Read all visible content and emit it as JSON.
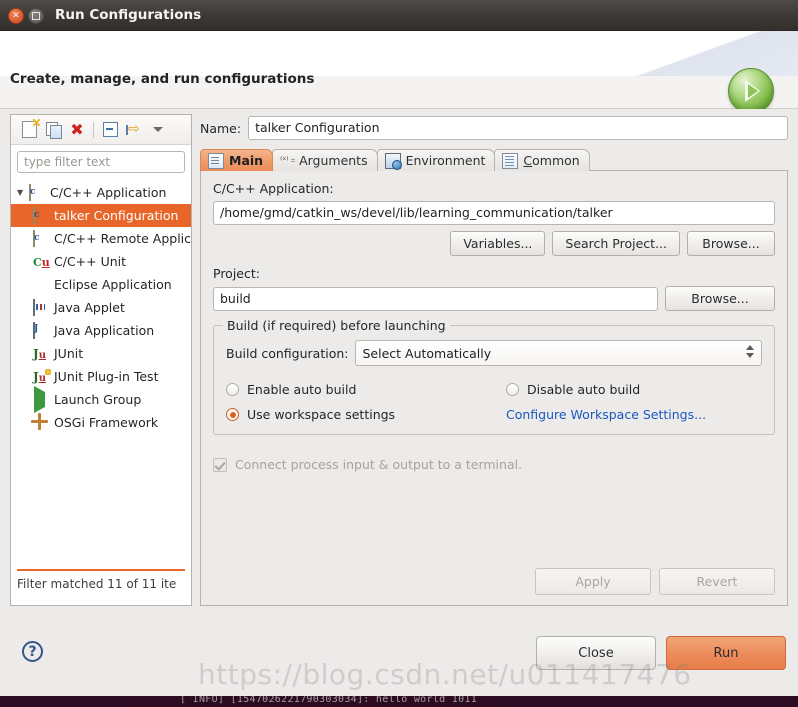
{
  "window": {
    "title": "Run Configurations",
    "close_icon": "close-icon",
    "maximize_icon": "maximize-icon"
  },
  "banner": {
    "heading": "Create, manage, and run configurations",
    "icon": "run-launch-icon"
  },
  "tree_toolbar": {
    "buttons": [
      {
        "name": "new-configuration-icon",
        "label": "New launch configuration"
      },
      {
        "name": "duplicate-icon",
        "label": "Duplicate"
      },
      {
        "name": "delete-icon",
        "label": "Delete"
      },
      {
        "name": "collapse-all-icon",
        "label": "Collapse All"
      },
      {
        "name": "filter-icon",
        "label": "Filter launch configurations"
      },
      {
        "name": "chevron-down-icon",
        "label": "View Menu"
      }
    ]
  },
  "filter": {
    "placeholder": "type filter text",
    "value": ""
  },
  "tree": {
    "items": [
      {
        "label": "C/C++ Application",
        "icon": "cpp-application-icon",
        "level": 0,
        "expanded": true,
        "selected": false
      },
      {
        "label": "talker Configuration",
        "icon": "cpp-application-icon",
        "level": 1,
        "expanded": false,
        "selected": true
      },
      {
        "label": "C/C++ Remote Applica",
        "icon": "cpp-remote-application-icon",
        "level": 0,
        "expanded": false,
        "selected": false
      },
      {
        "label": "C/C++ Unit",
        "icon": "cpp-unit-icon",
        "level": 0,
        "expanded": false,
        "selected": false
      },
      {
        "label": "Eclipse Application",
        "icon": "eclipse-application-icon",
        "level": 0,
        "expanded": false,
        "selected": false
      },
      {
        "label": "Java Applet",
        "icon": "java-applet-icon",
        "level": 0,
        "expanded": false,
        "selected": false
      },
      {
        "label": "Java Application",
        "icon": "java-application-icon",
        "level": 0,
        "expanded": false,
        "selected": false
      },
      {
        "label": "JUnit",
        "icon": "junit-icon",
        "level": 0,
        "expanded": false,
        "selected": false
      },
      {
        "label": "JUnit Plug-in Test",
        "icon": "junit-plugin-test-icon",
        "level": 0,
        "expanded": false,
        "selected": false
      },
      {
        "label": "Launch Group",
        "icon": "launch-group-icon",
        "level": 0,
        "expanded": false,
        "selected": false
      },
      {
        "label": "OSGi Framework",
        "icon": "osgi-framework-icon",
        "level": 0,
        "expanded": false,
        "selected": false
      }
    ],
    "status": "Filter matched 11 of 11 ite"
  },
  "form": {
    "name_label": "Name:",
    "name_value": "talker Configuration",
    "tabs": [
      {
        "label": "Main",
        "icon": "main-tab-icon",
        "active": true,
        "mnemonic": ""
      },
      {
        "label": "Arguments",
        "icon": "arguments-tab-icon",
        "active": false,
        "mnemonic": ""
      },
      {
        "label": "Environment",
        "icon": "environment-tab-icon",
        "active": false,
        "mnemonic": ""
      },
      {
        "label": "Common",
        "icon": "common-tab-icon",
        "active": false,
        "mnemonic": "C"
      }
    ],
    "application_label": "C/C++ Application:",
    "application_value": "/home/gmd/catkin_ws/devel/lib/learning_communication/talker",
    "variables_button": "Variables...",
    "search_project_button": "Search Project...",
    "browse_button_app": "Browse...",
    "project_label": "Project:",
    "project_value": "build",
    "browse_button_project": "Browse...",
    "build_group_title": "Build (if required) before launching",
    "build_config_label": "Build configuration:",
    "build_config_value": "Select Automatically",
    "radio_enable_auto_build": "Enable auto build",
    "radio_disable_auto_build": "Disable auto build",
    "radio_use_workspace_settings": "Use workspace settings",
    "configure_workspace_link": "Configure Workspace Settings...",
    "connect_terminal_label": "Connect process input & output to a terminal.",
    "apply_button": "Apply",
    "revert_button": "Revert"
  },
  "footer": {
    "help_icon": "help-icon",
    "close_button": "Close",
    "run_button": "Run"
  },
  "watermark": "https://blog.csdn.net/u011417476",
  "terminal_text": "[ INFO] [1547026221790303034]: hello world 1011",
  "colors": {
    "accent_orange": "#e8662a",
    "run_button": "#ed8f5d",
    "tab_active": "#ef9a69",
    "link_blue": "#1a57c0",
    "titlebar": "#3b3836"
  }
}
